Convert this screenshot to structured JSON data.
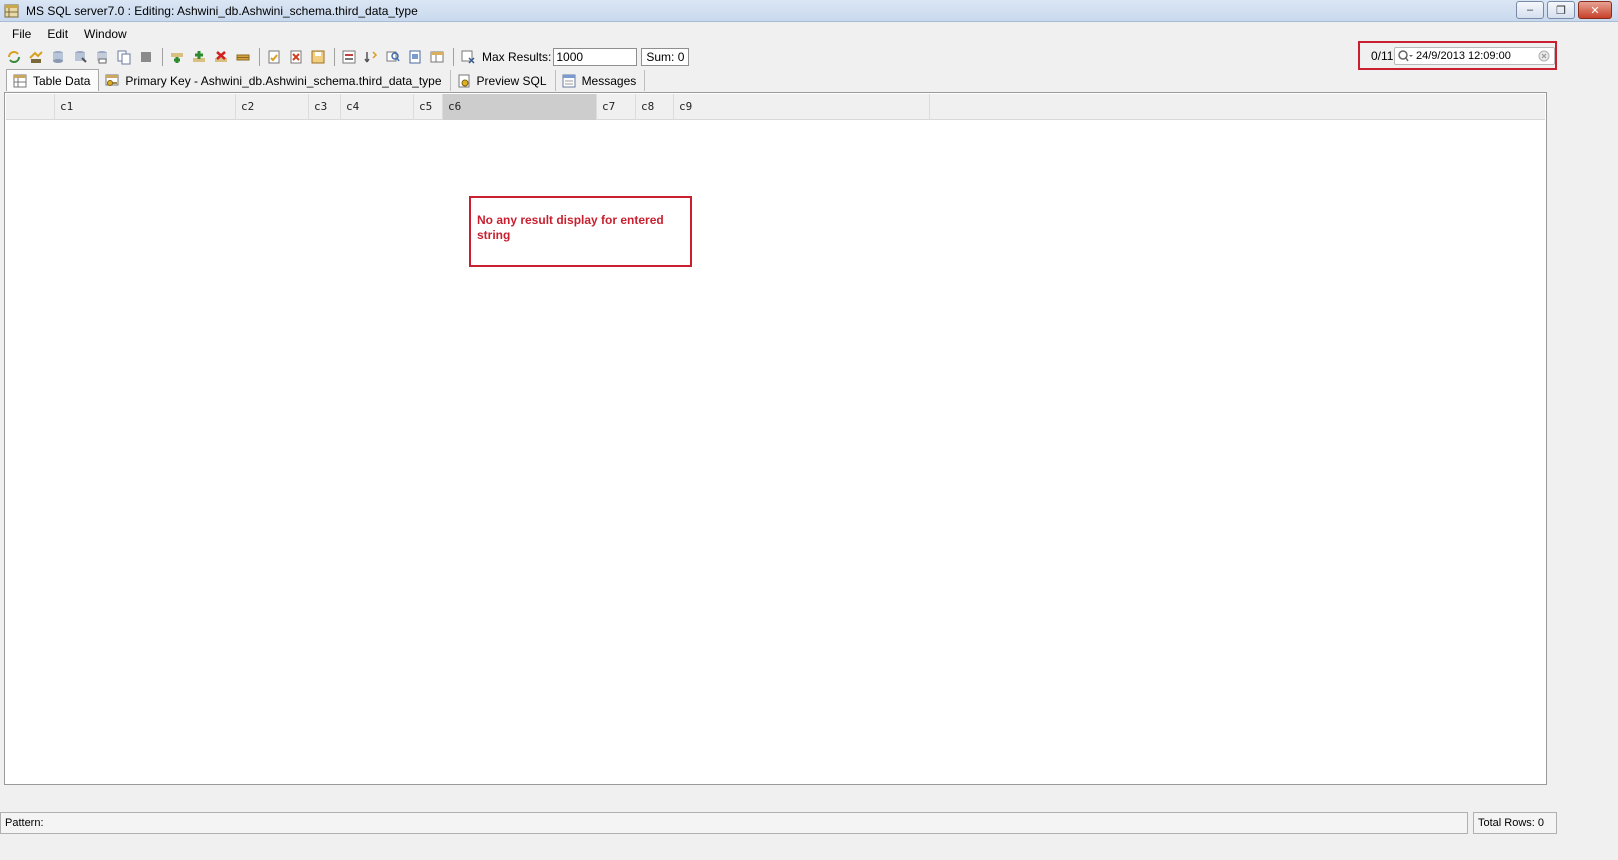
{
  "window": {
    "title": "MS SQL server7.0 : Editing: Ashwini_db.Ashwini_schema.third_data_type",
    "controls": {
      "minimize": "–",
      "maximize": "❐",
      "close": "✕"
    }
  },
  "menubar": {
    "items": [
      "File",
      "Edit",
      "Window"
    ]
  },
  "toolbar": {
    "icons": [
      "refresh-icon",
      "refresh-all-icon",
      "export-icon",
      "import-icon",
      "print-icon",
      "copy-icon",
      "stop-icon",
      "insert-row-icon",
      "add-row-icon",
      "delete-row-icon",
      "edit-row-icon",
      "commit-icon",
      "rollback-icon",
      "save-icon",
      "filter-icon",
      "sort-icon",
      "find-icon",
      "form-view-icon",
      "grid-view-icon",
      "close-results-icon"
    ],
    "max_results_label": "Max Results:",
    "max_results_value": "1000",
    "sum_label": "Sum: 0"
  },
  "search": {
    "count": "0/11",
    "value": "24/9/2013 12:09:00"
  },
  "tabs": [
    {
      "label": "Table Data",
      "icon": "table-icon",
      "active": true
    },
    {
      "label": "Primary Key - Ashwini_db.Ashwini_schema.third_data_type",
      "icon": "key-icon",
      "active": false
    },
    {
      "label": "Preview SQL",
      "icon": "sql-icon",
      "active": false
    },
    {
      "label": "Messages",
      "icon": "messages-icon",
      "active": false
    }
  ],
  "grid": {
    "columns": [
      "",
      "c1",
      "c2",
      "c3",
      "c4",
      "c5",
      "c6",
      "c7",
      "c8",
      "c9"
    ],
    "selected_column": "c6",
    "rows": []
  },
  "annotation": {
    "text": "No any result display for entered string"
  },
  "status": {
    "pattern_label": "Pattern:",
    "total_rows": "Total Rows: 0"
  },
  "colors": {
    "highlight": "#c8202f",
    "selected_column": "#cdcdcd"
  }
}
